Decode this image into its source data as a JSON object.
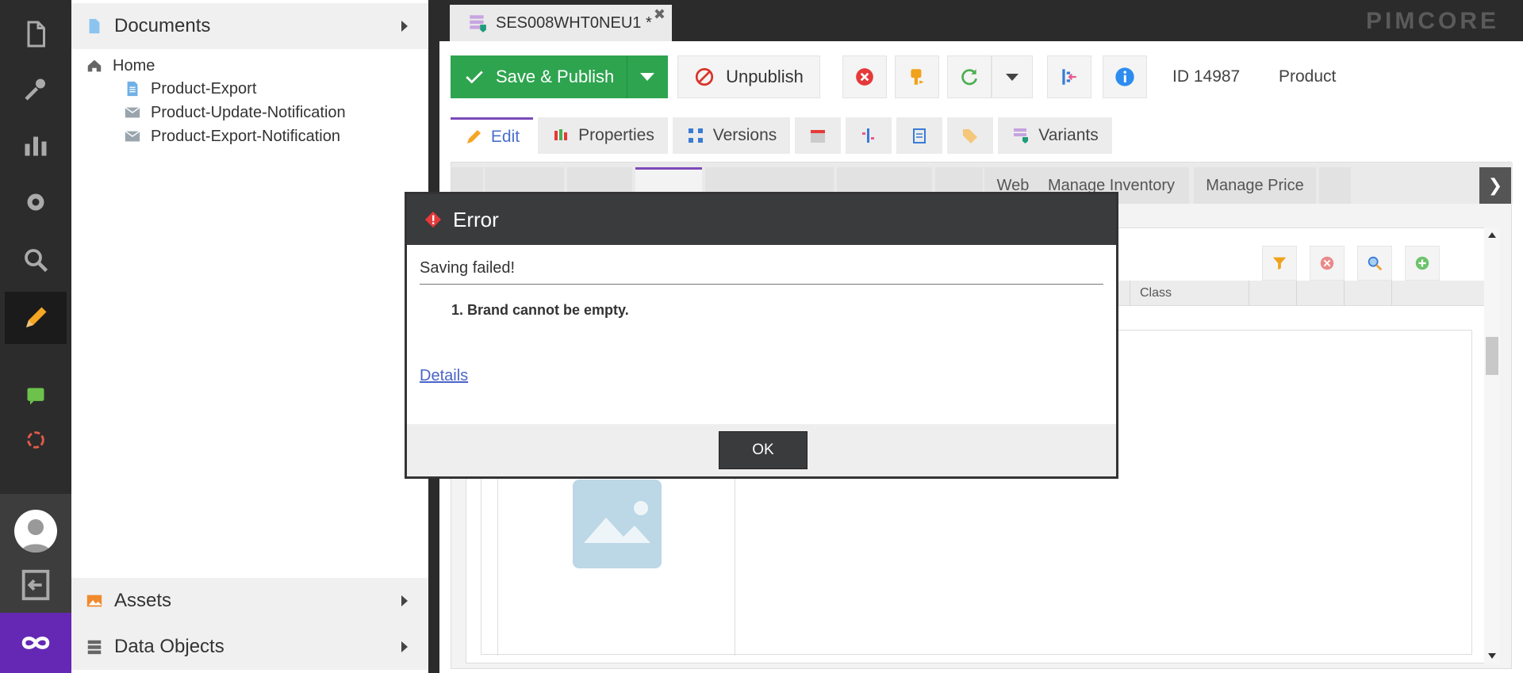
{
  "sidebar": {
    "documents_label": "Documents",
    "assets_label": "Assets",
    "data_objects_label": "Data Objects",
    "tree": [
      {
        "label": "Home"
      },
      {
        "label": "Product-Export"
      },
      {
        "label": "Product-Update-Notification"
      },
      {
        "label": "Product-Export-Notification"
      }
    ]
  },
  "header": {
    "doc_tab": "SES008WHT0NEU1 *",
    "logo": "PIMCORE"
  },
  "toolbar": {
    "save_publish": "Save & Publish",
    "unpublish": "Unpublish",
    "id_label": "ID 14987",
    "type_label": "Product"
  },
  "tabs": {
    "edit": "Edit",
    "properties": "Properties",
    "versions": "Versions",
    "variants": "Variants"
  },
  "subtabs": {
    "web": "Web",
    "manage_inventory": "Manage Inventory",
    "manage_price": "Manage Price"
  },
  "grid": {
    "class_col": "Class"
  },
  "modal": {
    "title": "Error",
    "message": "Saving failed!",
    "error_item": "1. Brand cannot be empty.",
    "details_link": "Details",
    "ok_label": "OK"
  },
  "colors": {
    "accent_green": "#2ea44f",
    "accent_purple": "#6428b4",
    "modal_header": "#3a3b3d"
  }
}
